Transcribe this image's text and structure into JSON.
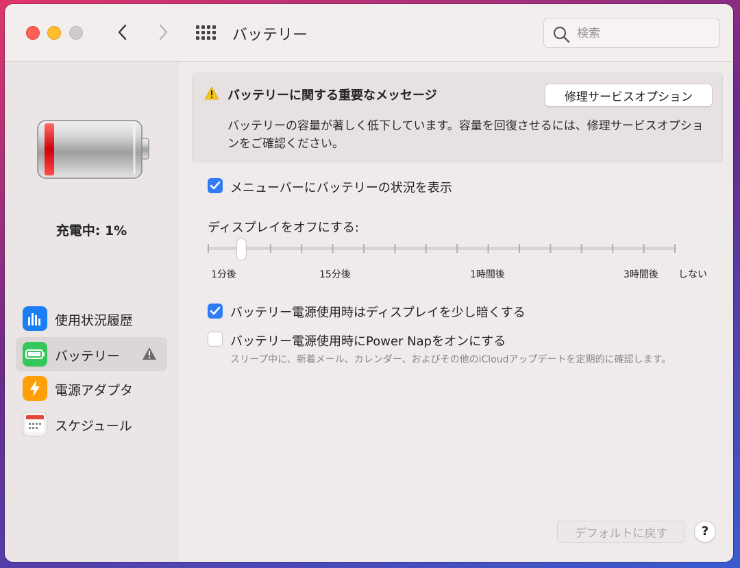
{
  "window": {
    "title": "バッテリー",
    "search_placeholder": "検索"
  },
  "sidebar": {
    "charge_status": "充電中: 1%",
    "battery_level": 0.01,
    "items": [
      {
        "label": "使用状況履歴",
        "icon": "bar-chart-icon",
        "color": "#1a7ef5"
      },
      {
        "label": "バッテリー",
        "icon": "battery-icon",
        "color": "#34c759",
        "active": true,
        "warning": true
      },
      {
        "label": "電源アダプタ",
        "icon": "lightning-icon",
        "color": "#fe9f0a"
      },
      {
        "label": "スケジュール",
        "icon": "calendar-icon",
        "color": "#e5e0e0"
      }
    ]
  },
  "banner": {
    "title": "バッテリーに関する重要なメッセージ",
    "button_label": "修理サービスオプション",
    "description": "バッテリーの容量が著しく低下しています。容量を回復させるには、修理サービスオプションをご確認ください。"
  },
  "options": {
    "show_in_menubar": {
      "label": "メニューバーにバッテリーの状況を表示",
      "checked": true
    },
    "dim_display": {
      "label": "バッテリー電源使用時はディスプレイを少し暗くする",
      "checked": true
    },
    "power_nap": {
      "label": "バッテリー電源使用時にPower Napをオンにする",
      "checked": false,
      "description": "スリープ中に、新着メール、カレンダー、およびその他のiCloudアップデートを定期的に確認します。"
    }
  },
  "display_off": {
    "label": "ディスプレイをオフにする:",
    "tick_labels": [
      "1分後",
      "15分後",
      "1時間後",
      "3時間後",
      "しない"
    ],
    "tick_count": 16,
    "selected_index": 1
  },
  "footer": {
    "default_button": "デフォルトに戻す",
    "help_button": "?"
  },
  "colors": {
    "accent": "#2f7cf6",
    "warning": "#f5c518"
  }
}
